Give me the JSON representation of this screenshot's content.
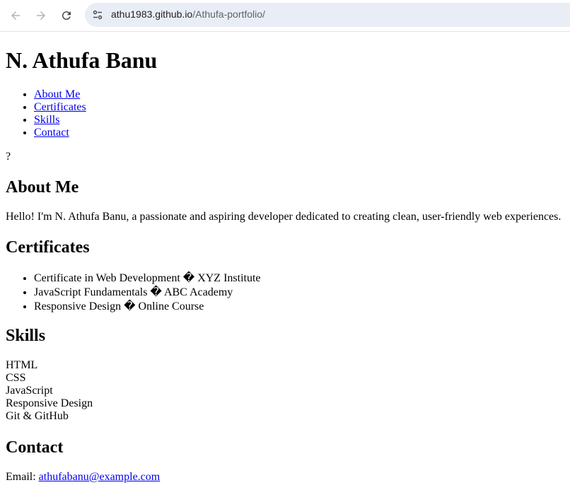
{
  "browser": {
    "url_host": "athu1983.github.io",
    "url_path": "/Athufa-portfolio/"
  },
  "page": {
    "name": "N. Athufa Banu",
    "nav": [
      "About Me",
      "Certificates",
      "Skills",
      "Contact"
    ],
    "stray_char": "?",
    "about": {
      "heading": "About Me",
      "text": "Hello! I'm N. Athufa Banu, a passionate and aspiring developer dedicated to creating clean, user-friendly web experiences."
    },
    "certificates": {
      "heading": "Certificates",
      "items": [
        "Certificate in Web Development � XYZ Institute",
        "JavaScript Fundamentals � ABC Academy",
        "Responsive Design � Online Course"
      ]
    },
    "skills": {
      "heading": "Skills",
      "items": [
        "HTML",
        "CSS",
        "JavaScript",
        "Responsive Design",
        "Git & GitHub"
      ]
    },
    "contact": {
      "heading": "Contact",
      "label": "Email: ",
      "email": "athufabanu@example.com"
    }
  }
}
